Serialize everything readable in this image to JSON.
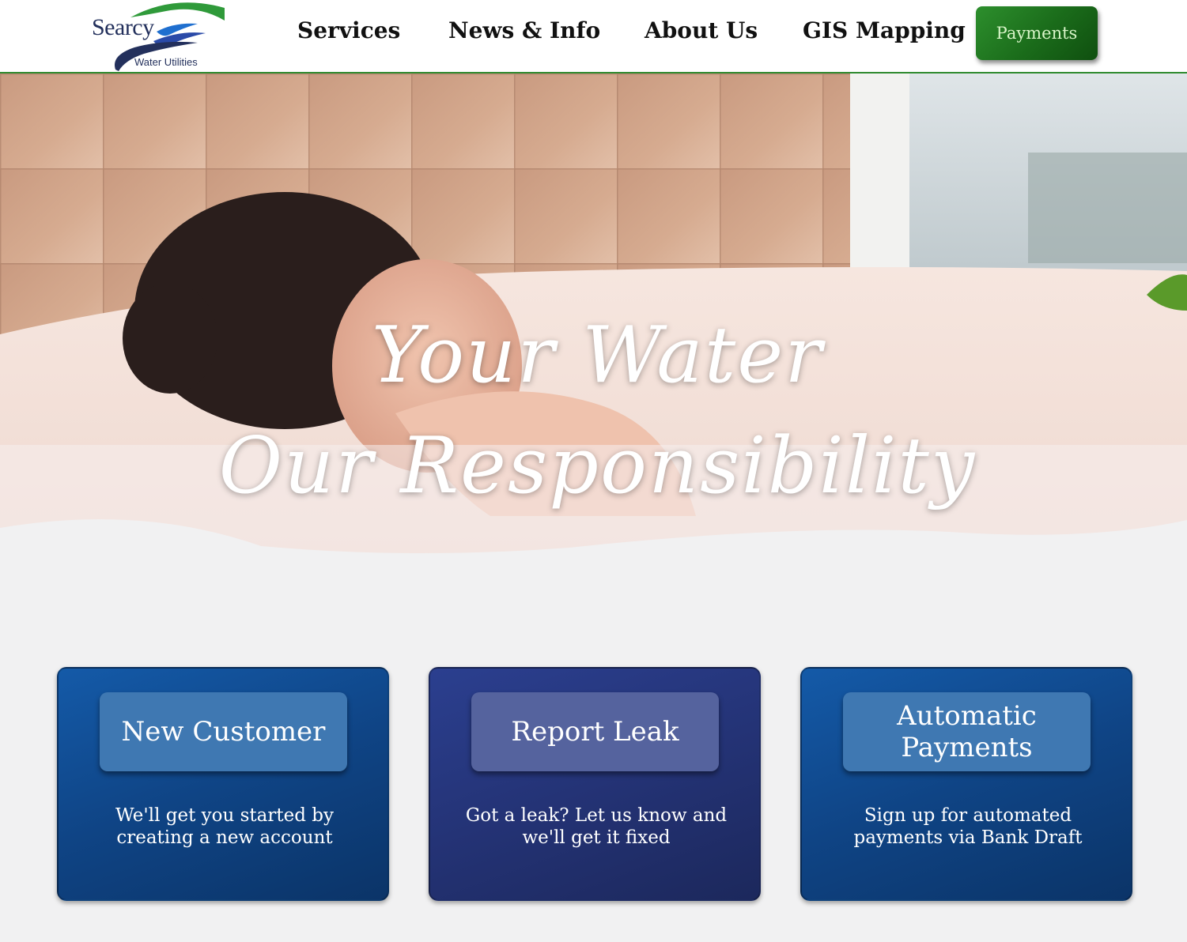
{
  "header": {
    "logo": {
      "word": "Searcy",
      "sub": "Water Utilities"
    },
    "nav": [
      {
        "label": "Services"
      },
      {
        "label": "News & Info"
      },
      {
        "label": "About Us"
      },
      {
        "label": "GIS Mapping"
      }
    ],
    "payments_label": "Payments"
  },
  "hero": {
    "line1": "Your Water",
    "line2": "Our Responsibility"
  },
  "cards": [
    {
      "title": "New Customer",
      "description": "We'll get you started by creating a new account"
    },
    {
      "title": "Report Leak",
      "description": "Got a leak? Let us know and we'll get it fixed"
    },
    {
      "title": "Automatic Payments",
      "description": "Sign up for automated payments via Bank Draft"
    }
  ],
  "colors": {
    "brand_green": "#2f8a2f",
    "brand_navy": "#23305c",
    "card_blue": "#0f4485",
    "card_indigo": "#243376"
  }
}
